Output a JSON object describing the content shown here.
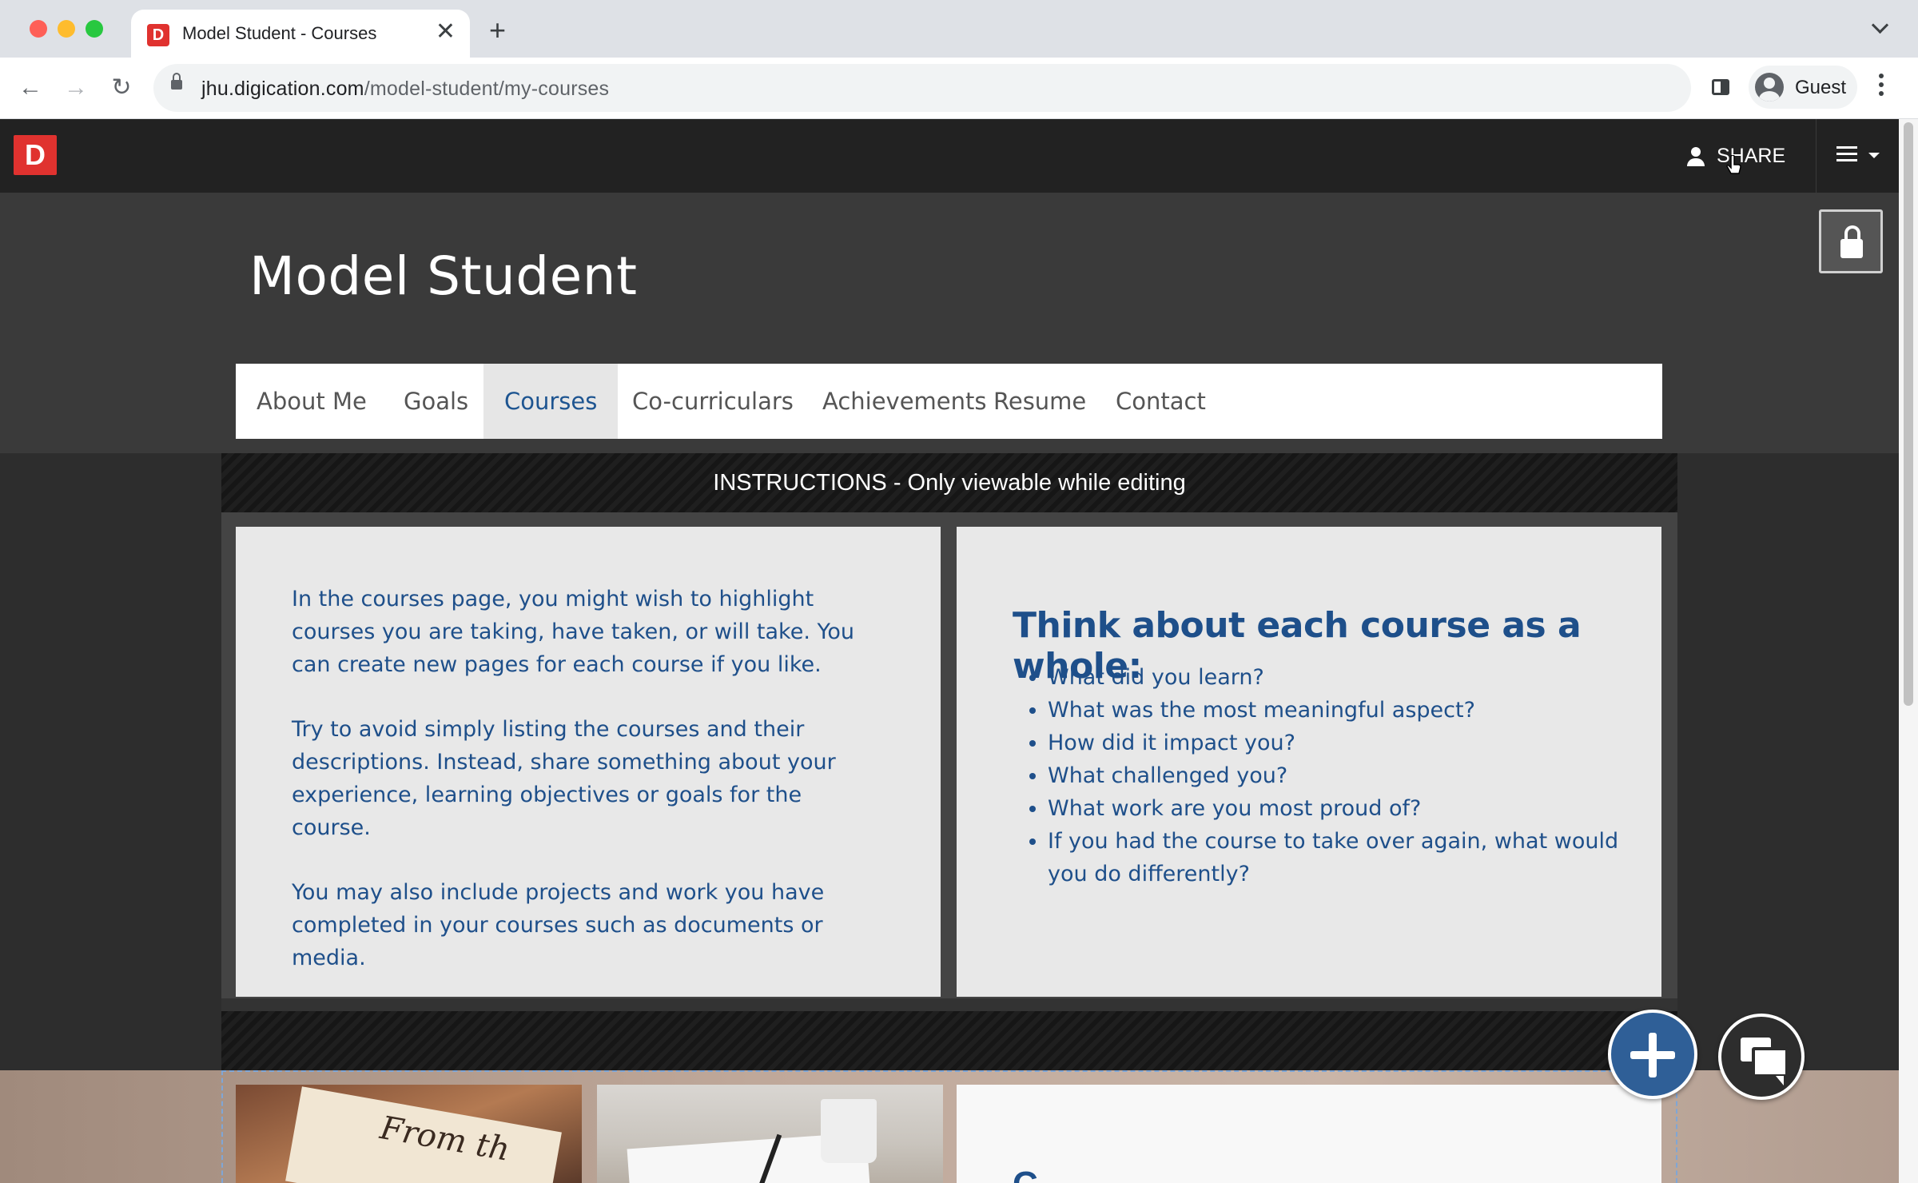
{
  "browser": {
    "tab_title": "Model Student - Courses",
    "tab_favicon_letter": "D",
    "tab_close": "✕",
    "new_tab": "+",
    "url_domain": "jhu.digication.com",
    "url_path": "/model-student/my-courses",
    "profile_name": "Guest",
    "icons": [
      "back-icon",
      "forward-icon",
      "reload-icon",
      "lock-icon",
      "side-panel-icon",
      "profile-avatar-icon",
      "kebab-menu-icon",
      "tab-list-chevron-icon"
    ]
  },
  "app": {
    "logo_letter": "D",
    "share_label": "SHARE",
    "brand_color": "#e0322f",
    "accent_color": "#1e5591"
  },
  "site": {
    "title": "Model Student",
    "nav": [
      {
        "label": "About Me",
        "active": false
      },
      {
        "label": "Goals",
        "active": false
      },
      {
        "label": "Courses",
        "active": true
      },
      {
        "label": "Co-curriculars",
        "active": false
      },
      {
        "label": "Achievements",
        "active": false
      },
      {
        "label": "Resume",
        "active": false
      },
      {
        "label": "Contact",
        "active": false
      }
    ]
  },
  "instructions": {
    "banner": "INSTRUCTIONS - Only viewable while editing",
    "left_paragraphs": [
      "In the courses page, you might wish to highlight courses you are taking, have taken, or will take. You can create new pages for each course if you like.",
      "Try to avoid simply listing the courses and their descriptions. Instead, share something about your experience, learning objectives or goals for the course.",
      "You may also include projects and work you have completed in your courses such as documents or media."
    ],
    "right_heading": "Think about each course as a whole:",
    "right_list": [
      "What did you learn?",
      "What was the most meaningful aspect?",
      "How did it impact you?",
      "What challenged you?",
      "What work are you most proud of?",
      "If you had the course to take over again, what would you do differently?"
    ]
  },
  "lower_section": {
    "photo1_text": "From th",
    "card_heading_partial": "C"
  },
  "fabs": {
    "add": "add-icon",
    "chat": "chat-icon"
  }
}
